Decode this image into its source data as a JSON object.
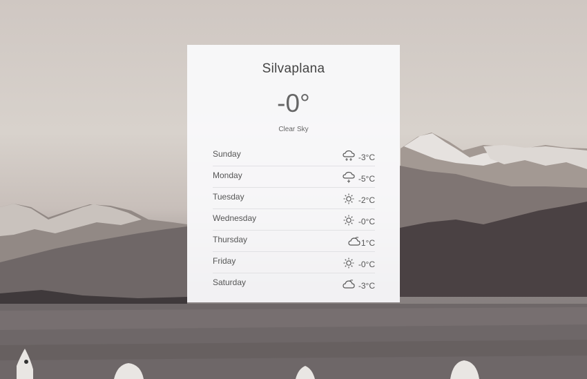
{
  "widget": {
    "city": "Silvaplana",
    "current_temp": "-0°",
    "condition": "Clear Sky"
  },
  "forecast": [
    {
      "day": "Sunday",
      "temp": "-3°C",
      "icon": "snow-cloud-icon"
    },
    {
      "day": "Monday",
      "temp": "-5°C",
      "icon": "snow-cloud-icon"
    },
    {
      "day": "Tuesday",
      "temp": "-2°C",
      "icon": "sun-icon"
    },
    {
      "day": "Wednesday",
      "temp": "-0°C",
      "icon": "sun-icon"
    },
    {
      "day": "Thursday",
      "temp": "1°C",
      "icon": "cloud-icon"
    },
    {
      "day": "Friday",
      "temp": "-0°C",
      "icon": "sun-icon"
    },
    {
      "day": "Saturday",
      "temp": "-3°C",
      "icon": "cloud-icon"
    }
  ],
  "colors": {
    "card": "#fafafc",
    "text": "#555555"
  }
}
